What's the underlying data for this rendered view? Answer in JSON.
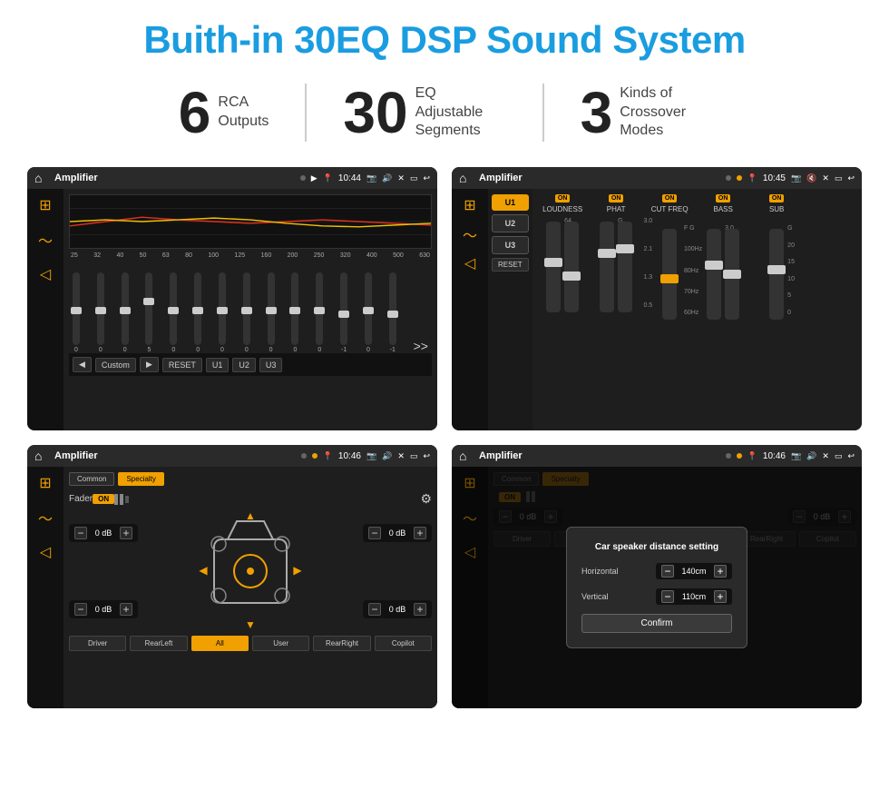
{
  "page": {
    "title": "Buith-in 30EQ DSP Sound System",
    "background": "#ffffff"
  },
  "stats": [
    {
      "number": "6",
      "label": "RCA\nOutputs"
    },
    {
      "number": "30",
      "label": "EQ Adjustable\nSegments"
    },
    {
      "number": "3",
      "label": "Kinds of\nCrossover Modes"
    }
  ],
  "screens": [
    {
      "id": "screen1",
      "app": "Amplifier",
      "time": "10:44",
      "type": "eq"
    },
    {
      "id": "screen2",
      "app": "Amplifier",
      "time": "10:45",
      "type": "amp"
    },
    {
      "id": "screen3",
      "app": "Amplifier",
      "time": "10:46",
      "type": "fader"
    },
    {
      "id": "screen4",
      "app": "Amplifier",
      "time": "10:46",
      "type": "distance"
    }
  ],
  "eq": {
    "frequencies": [
      "25",
      "32",
      "40",
      "50",
      "63",
      "80",
      "100",
      "125",
      "160",
      "200",
      "250",
      "320",
      "400",
      "500",
      "630"
    ],
    "values": [
      "0",
      "0",
      "0",
      "5",
      "0",
      "0",
      "0",
      "0",
      "0",
      "0",
      "0",
      "-1",
      "0",
      "-1"
    ],
    "preset": "Custom",
    "buttons": [
      "RESET",
      "U1",
      "U2",
      "U3"
    ]
  },
  "amp": {
    "presets": [
      "U1",
      "U2",
      "U3"
    ],
    "channels": [
      {
        "name": "LOUDNESS",
        "on": true
      },
      {
        "name": "PHAT",
        "on": true
      },
      {
        "name": "CUT FREQ",
        "on": true
      },
      {
        "name": "BASS",
        "on": true
      },
      {
        "name": "SUB",
        "on": true
      }
    ],
    "reset_label": "RESET"
  },
  "fader": {
    "tabs": [
      "Common",
      "Specialty"
    ],
    "label": "Fader",
    "on": true,
    "db_controls": [
      "0 dB",
      "0 dB",
      "0 dB",
      "0 dB"
    ],
    "bottom_buttons": [
      "Driver",
      "RearLeft",
      "All",
      "User",
      "RearRight",
      "Copilot"
    ]
  },
  "distance_dialog": {
    "title": "Car speaker distance setting",
    "horizontal_label": "Horizontal",
    "horizontal_value": "140cm",
    "vertical_label": "Vertical",
    "vertical_value": "110cm",
    "confirm_label": "Confirm"
  }
}
